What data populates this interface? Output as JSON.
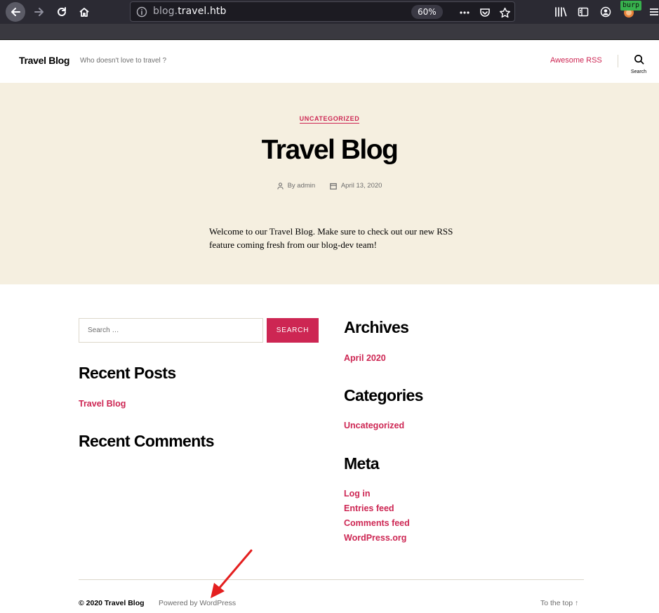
{
  "browser": {
    "url_host_dim": "blog.",
    "url_host_main": "travel.htb",
    "zoom": "60%",
    "extension_badge": "burp",
    "icons": {
      "back": "back-arrow-icon",
      "forward": "forward-arrow-icon",
      "reload": "reload-icon",
      "home": "home-icon",
      "info": "info-icon",
      "more": "more-dots-icon",
      "pocket": "pocket-icon",
      "bookmark": "star-icon",
      "library": "library-icon",
      "sidebar": "sidebar-icon",
      "account": "account-icon",
      "extension": "burp-extension-icon",
      "menu": "hamburger-menu-icon"
    }
  },
  "header": {
    "site_title": "Travel Blog",
    "site_description": "Who doesn't love to travel ?",
    "nav_link": "Awesome RSS",
    "search_label": "Search"
  },
  "post": {
    "category": "UNCATEGORIZED",
    "title": "Travel Blog",
    "author": "By admin",
    "date": "April 13, 2020",
    "body": "Welcome to our Travel Blog. Make sure to check out our new RSS feature coming fresh from our blog-dev team!"
  },
  "widgets": {
    "search_placeholder": "Search …",
    "search_button": "SEARCH",
    "recent_posts_title": "Recent Posts",
    "recent_posts": [
      "Travel Blog"
    ],
    "recent_comments_title": "Recent Comments",
    "archives_title": "Archives",
    "archives": [
      "April 2020"
    ],
    "categories_title": "Categories",
    "categories": [
      "Uncategorized"
    ],
    "meta_title": "Meta",
    "meta_links": [
      "Log in",
      "Entries feed",
      "Comments feed",
      "WordPress.org"
    ]
  },
  "footer": {
    "copyright": "© 2020 Travel Blog",
    "powered": "Powered by WordPress",
    "to_top": "To the top ↑"
  },
  "colors": {
    "accent": "#cd2653",
    "hero_background": "#f5efe0",
    "annotation_arrow": "#e41f1f"
  }
}
